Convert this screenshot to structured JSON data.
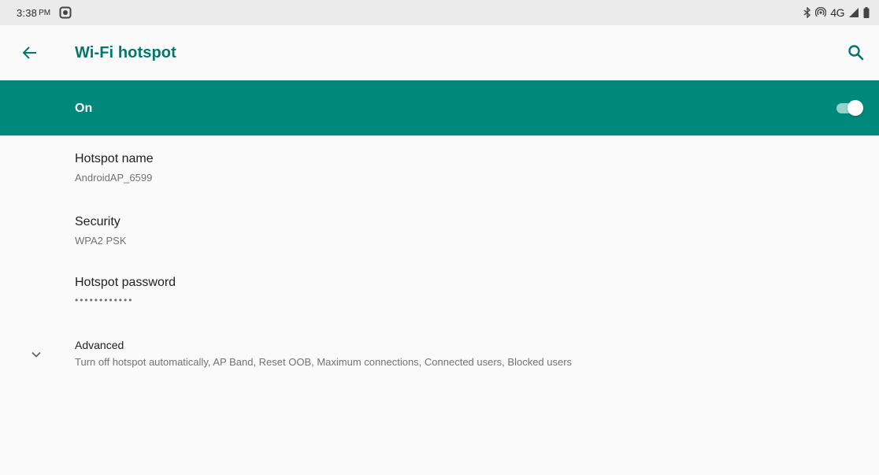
{
  "status_bar": {
    "time": "3:38",
    "ampm": "PM",
    "network": "4G",
    "icons": [
      "screen-record-icon",
      "bluetooth-icon",
      "hotspot-icon",
      "signal-icon",
      "battery-icon"
    ]
  },
  "toolbar": {
    "title": "Wi-Fi hotspot",
    "back_icon": "back-arrow-icon",
    "search_icon": "search-icon"
  },
  "master_switch": {
    "label": "On",
    "checked": true
  },
  "preferences": [
    {
      "title": "Hotspot name",
      "summary": "AndroidAP_6599"
    },
    {
      "title": "Security",
      "summary": "WPA2 PSK"
    },
    {
      "title": "Hotspot password",
      "summary": "••••••••••••"
    }
  ],
  "advanced": {
    "title": "Advanced",
    "summary": "Turn off hotspot automatically, AP Band, Reset OOB, Maximum connections, Connected users, Blocked users",
    "icon": "chevron-down-icon"
  },
  "colors": {
    "accent": "#00796b",
    "switch_bar": "#00897b",
    "background": "#fafafa",
    "status_bar": "#ebebeb"
  }
}
